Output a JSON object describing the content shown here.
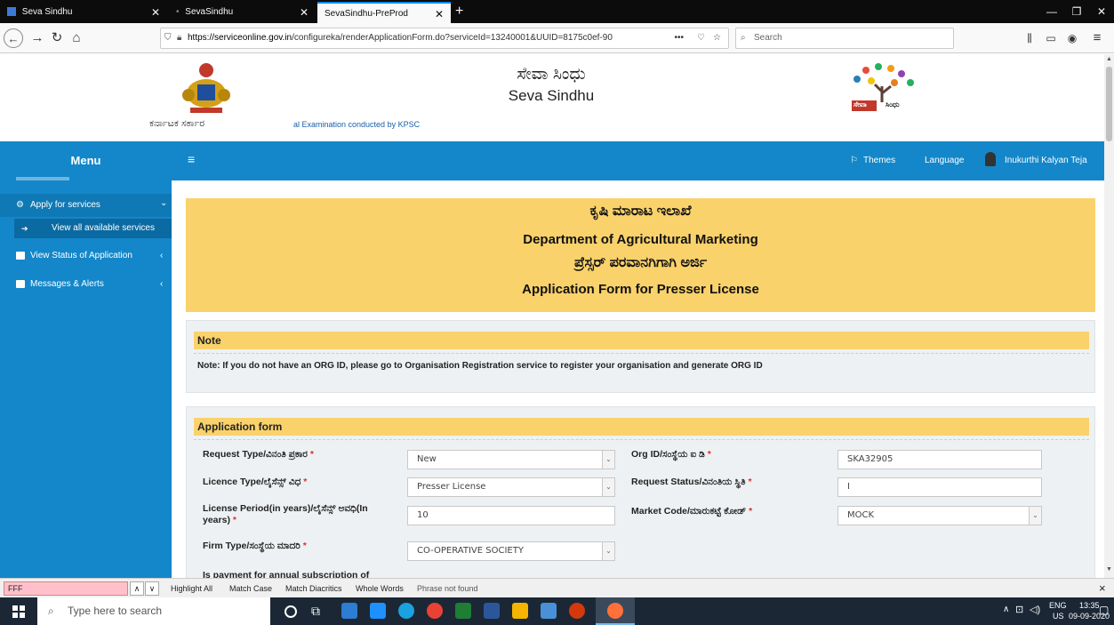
{
  "browser": {
    "tabs": [
      {
        "label": "Seva Sindhu"
      },
      {
        "label": "SevaSindhu"
      },
      {
        "label": "SevaSindhu-PreProd"
      }
    ],
    "url_prefix": "https://serviceonline.gov.in",
    "url_rest": "/configureka/renderApplicationForm.do?serviceId=13240001&UUID=8175c0ef-90",
    "url_dots": "•••",
    "search_placeholder": "Search"
  },
  "header": {
    "title_kn": "ಸೇವಾ ಸಿಂಧು",
    "title_en": "Seva Sindhu",
    "govt_label": "ಕರ್ನಾಟಕ ಸರ್ಕಾರ",
    "ticker": "al Examination conducted by KPSC",
    "logo_text_a": "ಸೇವಾ",
    "logo_text_b": "ಸಿಂಧು"
  },
  "sidebar": {
    "menu_title": "Menu",
    "items": [
      {
        "label": "Apply for services",
        "chevron": "⌄"
      },
      {
        "label": "View all available services"
      },
      {
        "label": "View Status of Application",
        "chevron": "‹"
      },
      {
        "label": "Messages & Alerts",
        "chevron": "‹"
      }
    ]
  },
  "topbar": {
    "hamburger": "≡",
    "themes": "Themes",
    "language": "Language",
    "user": "Inukurthi Kalyan Teja"
  },
  "banner": {
    "line1": "ಕೃಷಿ ಮಾರಾಟ ಇಲಾಖೆ",
    "line2": "Department of Agricultural Marketing",
    "line3": "ಪ್ರೆಸ್ಸರ್ ಪರವಾನಗಿಗಾಗಿ ಅರ್ಜಿ",
    "line4": "Application Form for Presser License"
  },
  "note": {
    "heading": "Note",
    "text": "Note: If you do not have an ORG ID, please go to Organisation Registration service to register your organisation and generate ORG ID"
  },
  "form": {
    "heading": "Application form",
    "fields": {
      "request_type": {
        "label": "Request Type/ವಿನಂತಿ ಪ್ರಕಾರ",
        "value": "New"
      },
      "licence_type": {
        "label": "Licence Type/ಲೈಸೆನ್ಸ್ ವಿಧ",
        "value": "Presser License"
      },
      "license_period": {
        "label": "License Period(in years)/ಲೈಸೆನ್ಸ್ ಅವಧಿ(In",
        "label2": "years)",
        "value": "10"
      },
      "firm_type": {
        "label": "Firm Type/ಸಂಸ್ಥೆಯ ಮಾದರಿ",
        "value": "CO-OPERATIVE SOCIETY"
      },
      "org_id": {
        "label": "Org ID/ಸಂಸ್ಥೆಯ ಐ ಡಿ",
        "value": "SKA32905"
      },
      "request_status": {
        "label": "Request Status/ವಿನಂತಿಯ ಸ್ಥಿತಿ",
        "value": "I"
      },
      "market_code": {
        "label": "Market Code/ಮಾರುಕಟ್ಟೆ ಕೋಡ್",
        "value": "MOCK"
      },
      "partial_label": "Is payment for annual subscription of"
    }
  },
  "findbar": {
    "query": "FFF",
    "highlight_all": "Highlight All",
    "match_case": "Match Case",
    "match_diacritics": "Match Diacritics",
    "whole_words": "Whole Words",
    "status": "Phrase not found",
    "close": "×"
  },
  "taskbar": {
    "search_placeholder": "Type here to search",
    "lang1": "ENG",
    "lang2": "US",
    "time": "13:35",
    "date": "09-09-2020"
  },
  "colors": {
    "sidebar_blue": "#1387c9",
    "banner_yellow": "#fad26b",
    "panel_grey": "#eef1f3"
  }
}
